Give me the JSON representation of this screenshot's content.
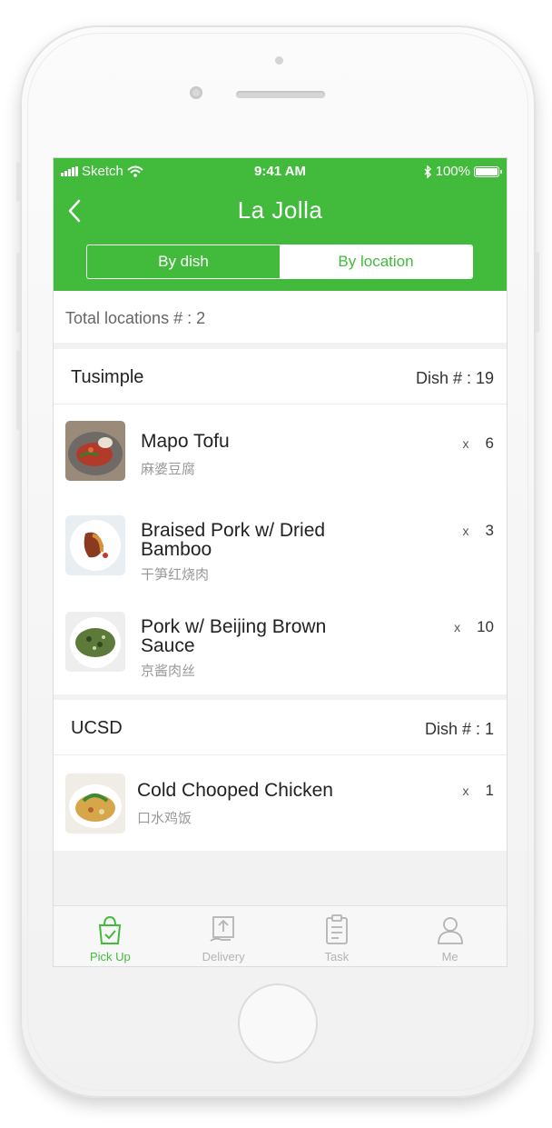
{
  "status_bar": {
    "carrier": "Sketch",
    "time": "9:41 AM",
    "battery": "100%",
    "battery_level": 1.0
  },
  "header": {
    "title": "La Jolla",
    "back_icon": "chevron-left-icon"
  },
  "segmented": {
    "options": [
      {
        "label": "By dish",
        "active": true
      },
      {
        "label": "By location",
        "active": false
      }
    ]
  },
  "summary": {
    "text": "Total locations # : 2"
  },
  "groups": [
    {
      "name": "Tusimple",
      "count_text": "Dish # : 19",
      "items": [
        {
          "name": "Mapo Tofu",
          "subtitle": "麻婆豆腐",
          "x": "x",
          "qty": "6"
        },
        {
          "name": "Braised Pork w/ Dried Bamboo",
          "subtitle": "干笋红烧肉",
          "x": "x",
          "qty": "3"
        },
        {
          "name": "Pork w/ Beijing Brown Sauce",
          "subtitle": "京酱肉丝",
          "x": "x",
          "qty": "10"
        }
      ]
    },
    {
      "name": "UCSD",
      "count_text": "Dish # :  1",
      "items": [
        {
          "name": "Cold Chooped Chicken",
          "subtitle": "口水鸡饭",
          "x": "x",
          "qty": "1"
        }
      ]
    }
  ],
  "tabbar": [
    {
      "label": "Pick Up",
      "icon": "pickup-bag-icon",
      "active": true
    },
    {
      "label": "Delivery",
      "icon": "delivery-box-icon",
      "active": false
    },
    {
      "label": "Task",
      "icon": "clipboard-icon",
      "active": false
    },
    {
      "label": "Me",
      "icon": "user-icon",
      "active": false
    }
  ],
  "colors": {
    "brand": "#42bb3c",
    "background": "#f2f2f2",
    "muted_text": "#999999"
  }
}
